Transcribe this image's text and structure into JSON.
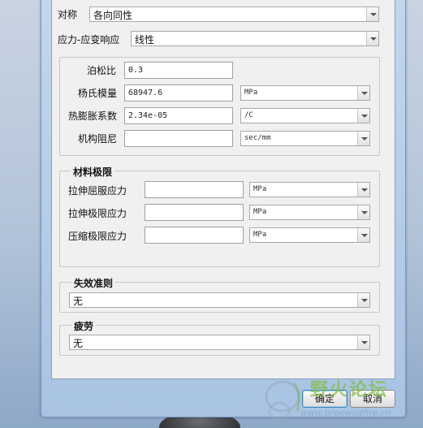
{
  "symmetry": {
    "label": "对称",
    "value": "各向同性"
  },
  "stress_strain": {
    "label": "应力-应变响应",
    "value": "线性"
  },
  "properties": {
    "poisson": {
      "label": "泊松比",
      "value": "0.3"
    },
    "youngs": {
      "label": "杨氏模量",
      "value": "68947.6",
      "unit": "MPa"
    },
    "thermal": {
      "label": "热膨胀系数",
      "value": "2.34e-05",
      "unit": "/C"
    },
    "damping": {
      "label": "机构阻尼",
      "value": "",
      "unit": "sec/mm"
    }
  },
  "limits": {
    "title": "材料极限",
    "tensile_yield": {
      "label": "拉伸屈服应力",
      "value": "",
      "unit": "MPa"
    },
    "tensile_ultimate": {
      "label": "拉伸极限应力",
      "value": "",
      "unit": "MPa"
    },
    "compressive_ultimate": {
      "label": "压缩极限应力",
      "value": "",
      "unit": "MPa"
    }
  },
  "failure": {
    "title": "失效准则",
    "value": "无"
  },
  "fatigue": {
    "title": "疲劳",
    "value": "无"
  },
  "buttons": {
    "ok": "确定",
    "cancel": "取消"
  },
  "watermark": {
    "text": "野火论坛",
    "url": "www.proewildfire.cn"
  }
}
